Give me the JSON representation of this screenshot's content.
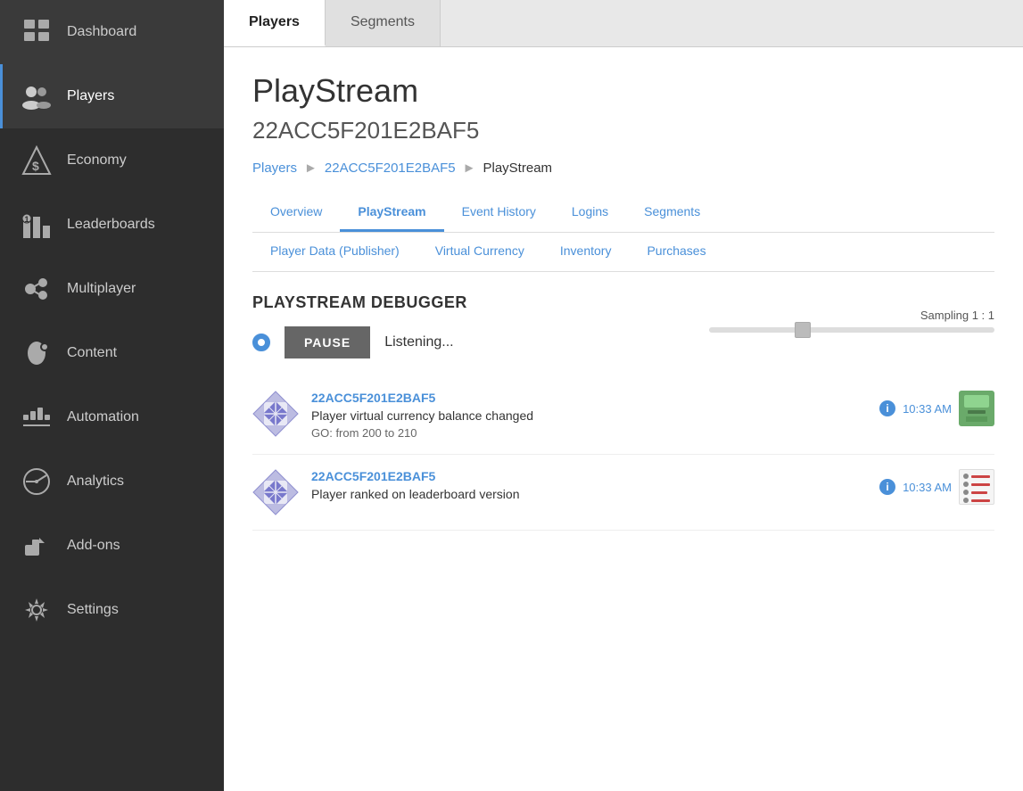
{
  "sidebar": {
    "items": [
      {
        "id": "dashboard",
        "label": "Dashboard",
        "icon": "grid-icon",
        "active": false
      },
      {
        "id": "players",
        "label": "Players",
        "icon": "players-icon",
        "active": true
      },
      {
        "id": "economy",
        "label": "Economy",
        "icon": "economy-icon",
        "active": false
      },
      {
        "id": "leaderboards",
        "label": "Leaderboards",
        "icon": "leaderboards-icon",
        "active": false
      },
      {
        "id": "multiplayer",
        "label": "Multiplayer",
        "icon": "multiplayer-icon",
        "active": false
      },
      {
        "id": "content",
        "label": "Content",
        "icon": "content-icon",
        "active": false
      },
      {
        "id": "automation",
        "label": "Automation",
        "icon": "automation-icon",
        "active": false
      },
      {
        "id": "analytics",
        "label": "Analytics",
        "icon": "analytics-icon",
        "active": false
      },
      {
        "id": "addons",
        "label": "Add-ons",
        "icon": "addons-icon",
        "active": false
      },
      {
        "id": "settings",
        "label": "Settings",
        "icon": "settings-icon",
        "active": false
      }
    ]
  },
  "top_tabs": [
    {
      "id": "players-tab",
      "label": "Players",
      "active": true
    },
    {
      "id": "segments-tab",
      "label": "Segments",
      "active": false
    }
  ],
  "page": {
    "title": "PlayStream",
    "player_id": "22ACC5F201E2BAF5"
  },
  "breadcrumb": {
    "players_link": "Players",
    "player_id_link": "22ACC5F201E2BAF5",
    "current": "PlayStream"
  },
  "sub_tabs_row1": [
    {
      "id": "overview",
      "label": "Overview",
      "active": false
    },
    {
      "id": "playstream",
      "label": "PlayStream",
      "active": true
    },
    {
      "id": "event-history",
      "label": "Event History",
      "active": false
    },
    {
      "id": "logins",
      "label": "Logins",
      "active": false
    },
    {
      "id": "segments",
      "label": "Segments",
      "active": false
    }
  ],
  "sub_tabs_row2": [
    {
      "id": "player-data-publisher",
      "label": "Player Data (Publisher)",
      "active": false
    },
    {
      "id": "virtual-currency",
      "label": "Virtual Currency",
      "active": false
    },
    {
      "id": "inventory",
      "label": "Inventory",
      "active": false
    },
    {
      "id": "purchases",
      "label": "Purchases",
      "active": false
    }
  ],
  "debugger": {
    "title": "PLAYSTREAM DEBUGGER",
    "sampling_label": "Sampling 1 : 1",
    "pause_button": "PAUSE",
    "listening_text": "Listening..."
  },
  "events": [
    {
      "id": "event-1",
      "player_id": "22ACC5F201E2BAF5",
      "description": "Player virtual currency balance changed",
      "detail": "GO: from 200 to 210",
      "time": "10:33 AM",
      "icon_type": "atm"
    },
    {
      "id": "event-2",
      "player_id": "22ACC5F201E2BAF5",
      "description": "Player ranked on leaderboard version",
      "detail": "",
      "time": "10:33 AM",
      "icon_type": "leaderboard"
    }
  ]
}
